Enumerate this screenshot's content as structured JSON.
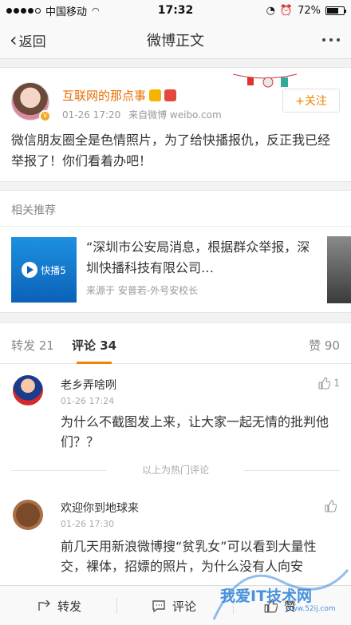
{
  "status_bar": {
    "carrier": "中国移动",
    "time": "17:32",
    "battery_percent": "72%",
    "battery_level": 0.72
  },
  "nav": {
    "back_label": "返回",
    "title": "微博正文"
  },
  "post": {
    "author": "互联网的那点事",
    "timestamp": "01-26 17:20",
    "source": "来自微博 weibo.com",
    "follow_label": "+关注",
    "text": "微信朋友圈全是色情照片，为了给快播报仇，反正我已经举报了！你们看着办吧！"
  },
  "related": {
    "section_title": "相关推荐",
    "thumb_text": "快播5",
    "headline": "“深圳市公安局消息，根据群众举报，深圳快播科技有限公司…",
    "source": "来源于 安普若-外号安校长"
  },
  "tabs": {
    "repost": "转发 21",
    "comment": "评论 34",
    "like": "赞 90"
  },
  "comments": [
    {
      "name": "老乡弄啥咧",
      "time": "01-26 17:24",
      "text": "为什么不截图发上来，让大家一起无情的批判他们？？",
      "likes": "1"
    },
    {
      "name": "欢迎你到地球来",
      "time": "01-26 17:30",
      "text": "前几天用新浪微博搜“贫乳女”可以看到大量性交，裸体，招嫖的照片，为什么没有人向安",
      "likes": ""
    }
  ],
  "hot_comment_label": "以上为热门评论",
  "bottom_bar": {
    "repost": "转发",
    "comment": "评论",
    "like": "赞"
  },
  "watermark": {
    "text": "我爱IT技术网",
    "url": "www.52ij.com"
  },
  "colors": {
    "accent": "#f08400",
    "username": "#e86c00",
    "watermark": "#2a7fd8"
  }
}
